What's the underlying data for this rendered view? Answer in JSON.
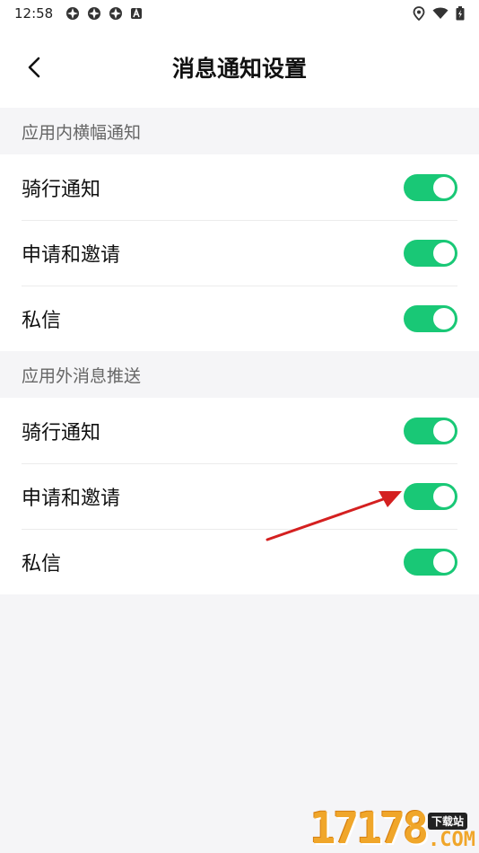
{
  "status_bar": {
    "time": "12:58",
    "left_icons": [
      "app-notification-icon",
      "app-notification-icon",
      "app-notification-icon",
      "a-notification-icon"
    ],
    "right_icons": [
      "location-icon",
      "wifi-icon",
      "battery-icon"
    ]
  },
  "header": {
    "title": "消息通知设置",
    "back_icon": "chevron-left-icon"
  },
  "sections": [
    {
      "label": "应用内横幅通知",
      "items": [
        {
          "label": "骑行通知",
          "enabled": true
        },
        {
          "label": "申请和邀请",
          "enabled": true
        },
        {
          "label": "私信",
          "enabled": true
        }
      ]
    },
    {
      "label": "应用外消息推送",
      "items": [
        {
          "label": "骑行通知",
          "enabled": true
        },
        {
          "label": "申请和邀请",
          "enabled": true
        },
        {
          "label": "私信",
          "enabled": true
        }
      ]
    }
  ],
  "colors": {
    "toggle_on": "#19c876",
    "background": "#f5f5f7",
    "annotation_arrow": "#d42020"
  },
  "watermark": {
    "number": "17178",
    "tag": "下载站",
    "suffix": ".COM"
  }
}
